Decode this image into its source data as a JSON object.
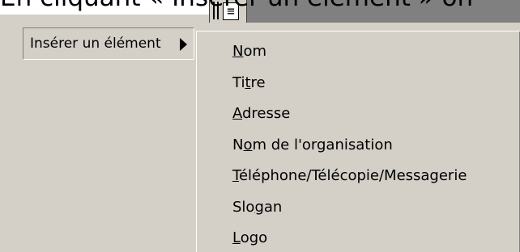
{
  "document": {
    "visible_text": "En cliquant « Insérer un élément » on"
  },
  "toolbar": {
    "icon": "text-box-icon",
    "icon_glyph": "≡"
  },
  "menu": {
    "parent_label": "Insérer un élément",
    "submenu_items": [
      {
        "label": "Nom",
        "access_key": "N"
      },
      {
        "label": "Titre",
        "access_key": "t"
      },
      {
        "label": "Adresse",
        "access_key": "A"
      },
      {
        "label": "Nom de l'organisation",
        "access_key": "o"
      },
      {
        "label": "Téléphone/Télécopie/Messagerie",
        "access_key": "T"
      },
      {
        "label": "Slogan",
        "access_key": "g"
      },
      {
        "label": "Logo",
        "access_key": "L"
      }
    ]
  },
  "colors": {
    "menu_face": "#d4d0c8",
    "toolbar_dark": "#808080"
  }
}
